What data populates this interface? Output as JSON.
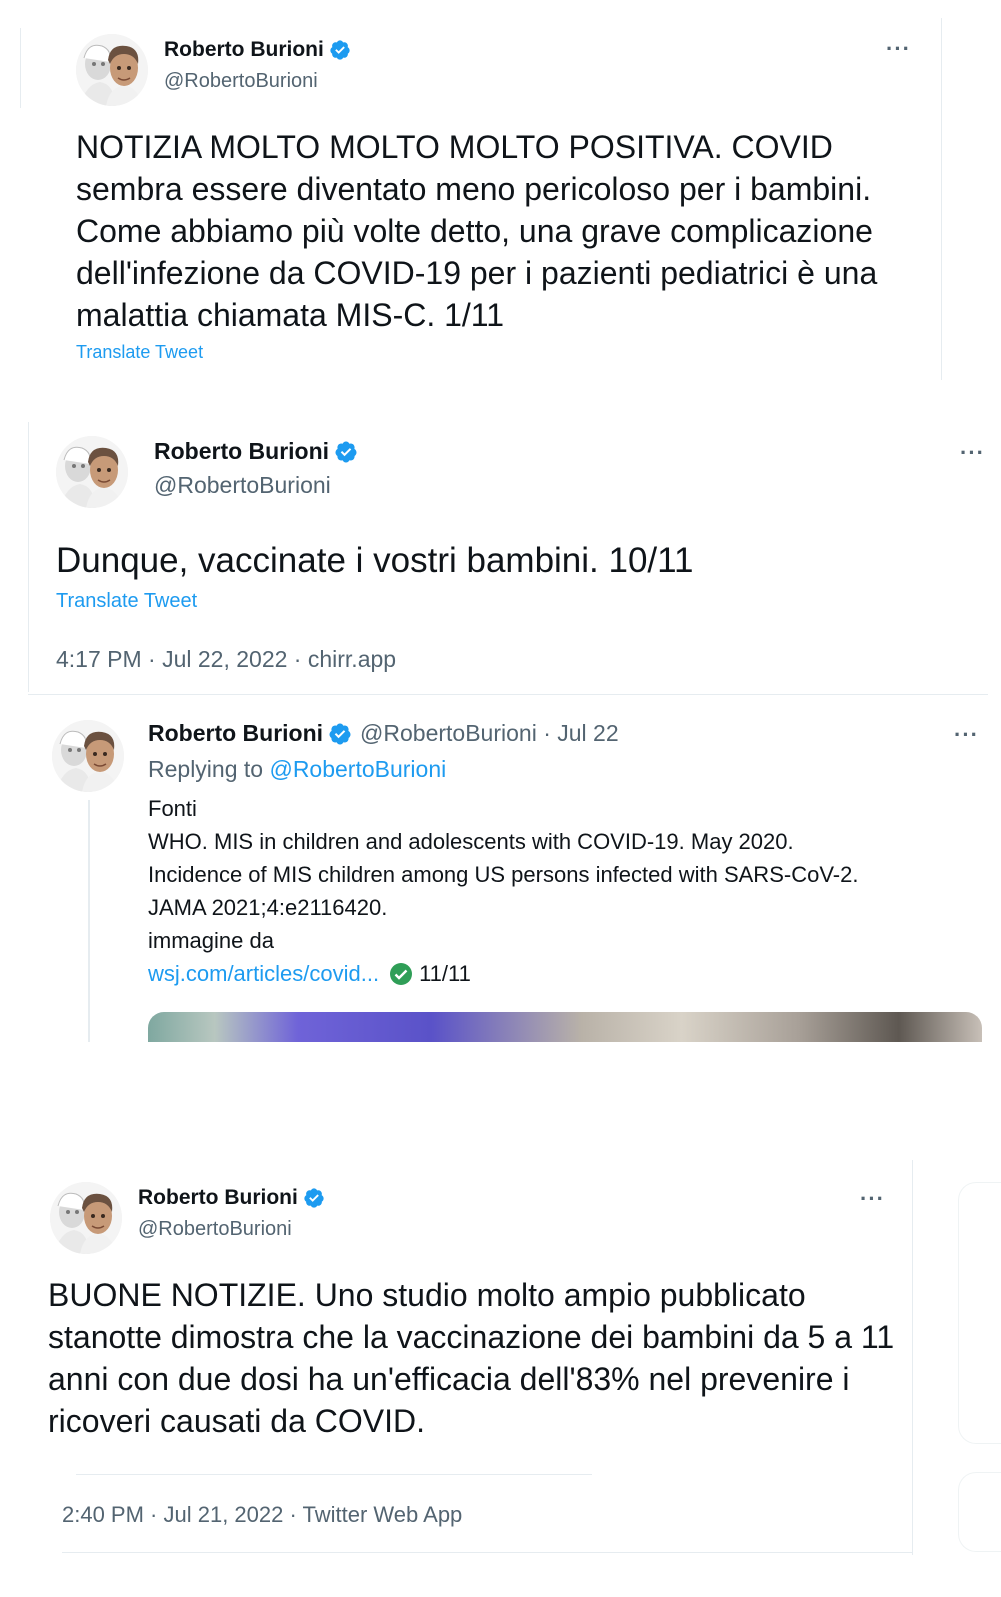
{
  "tweet1": {
    "display_name": "Roberto Burioni",
    "handle": "@RobertoBurioni",
    "more_icon": "more-horizontal-icon",
    "text": "NOTIZIA MOLTO MOLTO MOLTO POSITIVA. COVID sembra essere diventato meno pericoloso per i bambini. Come abbiamo più volte detto, una grave complicazione dell'infezione da COVID-19 per i pazienti pediatrici è una malattia chiamata MIS-C. 1/11",
    "translate_label": "Translate Tweet"
  },
  "tweet2": {
    "display_name": "Roberto Burioni",
    "handle": "@RobertoBurioni",
    "text": "Dunque, vaccinate i vostri bambini. 10/11",
    "translate_label": "Translate Tweet",
    "meta": "4:17 PM · Jul 22, 2022 · chirr.app",
    "reply": {
      "display_name": "Roberto Burioni",
      "handle_date": "@RobertoBurioni · Jul 22",
      "replying_prefix": "Replying to ",
      "replying_handle": "@RobertoBurioni",
      "lines": [
        "Fonti",
        "WHO. MIS in children and adolescents with COVID-19. May 2020.",
        "Incidence of MIS children among US persons infected with SARS-CoV-2.",
        "JAMA 2021;4:e2116420.",
        "immagine da"
      ],
      "link": "wsj.com/articles/covid...",
      "count": "11/11"
    }
  },
  "tweet3": {
    "display_name": "Roberto Burioni",
    "handle": "@RobertoBurioni",
    "text": "BUONE NOTIZIE. Uno studio molto ampio pubblicato stanotte dimostra che la vaccinazione dei bambini da 5 a 11 anni con due dosi ha un'efficacia dell'83% nel prevenire i ricoveri causati da COVID.",
    "meta": "2:40 PM · Jul 21, 2022 · Twitter Web App"
  },
  "colors": {
    "text": "#0f1419",
    "secondary": "#536471",
    "link": "#1d9bf0",
    "verified": "#1d9bf0",
    "check_green": "#2f9e57"
  }
}
